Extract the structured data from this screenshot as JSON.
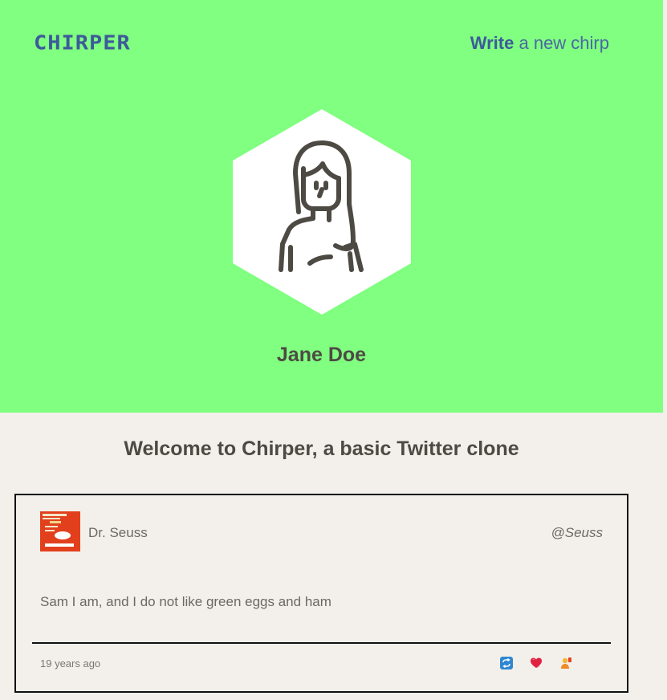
{
  "header": {
    "logo": "CHIRPER",
    "nav_write_strong": "Write",
    "nav_write_rest": "a new chirp"
  },
  "profile": {
    "name": "Jane Doe",
    "avatar_icon": "woman-avatar-icon"
  },
  "main": {
    "welcome": "Welcome to Chirper, a basic Twitter clone"
  },
  "chirps": [
    {
      "author": "Dr. Seuss",
      "handle": "@Seuss",
      "text": "Sam I am, and I do not like green eggs and ham",
      "time": "19 years ago",
      "actions": [
        "rechirp-icon",
        "heart-icon",
        "reply-icon"
      ]
    }
  ],
  "colors": {
    "hero_bg": "#80ff80",
    "page_bg": "#f3f0eb",
    "brand": "#3d5a9a",
    "text_dark": "#4d4a44"
  }
}
